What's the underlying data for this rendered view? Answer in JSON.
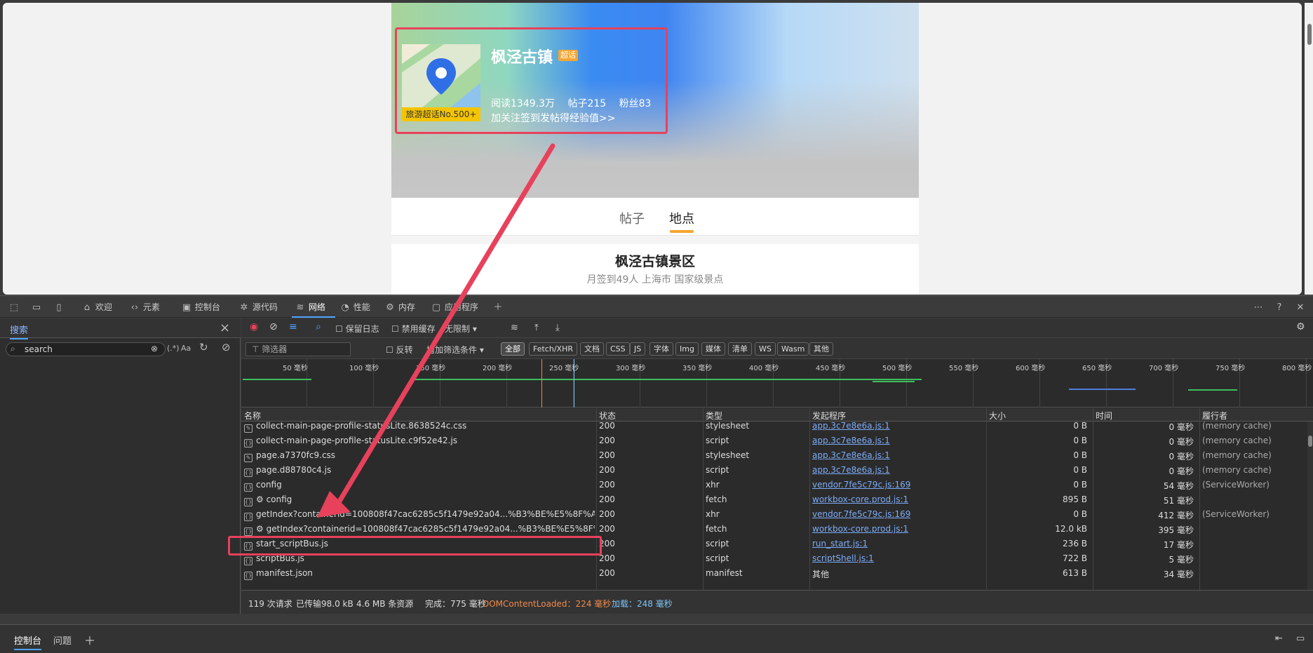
{
  "page": {
    "topic_title": "枫泾古镇",
    "topic_badge": "超话",
    "rank_label": "旅游超话No.500+",
    "stats": {
      "reads": "阅读1349.3万",
      "posts": "帖子215",
      "fans": "粉丝83"
    },
    "cta": "加关注签到发帖得经验值>>",
    "tabs": [
      "帖子",
      "地点"
    ],
    "card_title": "枫泾古镇景区",
    "card_sub": "月签到49人 上海市 国家级景点"
  },
  "devtools": {
    "tabs": [
      "欢迎",
      "元素",
      "控制台",
      "源代码",
      "网络",
      "性能",
      "内存",
      "应用程序"
    ],
    "active_tab": "网络",
    "search": {
      "tab": "搜索",
      "value": "search",
      "regex": "(.*)",
      "case": "Aa"
    },
    "network_bar": {
      "preserve_log": "保留日志",
      "disable_cache": "禁用缓存",
      "throttle": "无限制"
    },
    "filter": {
      "placeholder": "筛选器",
      "invert": "反转",
      "more": "增加筛选条件"
    },
    "chips": [
      "全部",
      "Fetch/XHR",
      "文档",
      "CSS",
      "JS",
      "字体",
      "Img",
      "媒体",
      "清单",
      "WS",
      "Wasm",
      "其他"
    ],
    "timeline_ticks": [
      "50 毫秒",
      "100 毫秒",
      "150 毫秒",
      "200 毫秒",
      "250 毫秒",
      "300 毫秒",
      "350 毫秒",
      "400 毫秒",
      "450 毫秒",
      "500 毫秒",
      "550 毫秒",
      "600 毫秒",
      "650 毫秒",
      "700 毫秒",
      "750 毫秒",
      "800 毫秒"
    ],
    "columns": [
      "名称",
      "状态",
      "类型",
      "发起程序",
      "大小",
      "时间",
      "履行者"
    ],
    "rows": [
      {
        "name": "collect-main-page-profile-statusLite.8638524c.css",
        "status": "200",
        "type": "stylesheet",
        "initiator": "app.3c7e8e6a.js:1",
        "size": "0 B",
        "time": "0 毫秒",
        "fulfilled": "(memory cache)"
      },
      {
        "name": "collect-main-page-profile-statusLite.c9f52e42.js",
        "status": "200",
        "type": "script",
        "initiator": "app.3c7e8e6a.js:1",
        "size": "0 B",
        "time": "0 毫秒",
        "fulfilled": "(memory cache)"
      },
      {
        "name": "page.a7370fc9.css",
        "status": "200",
        "type": "stylesheet",
        "initiator": "app.3c7e8e6a.js:1",
        "size": "0 B",
        "time": "0 毫秒",
        "fulfilled": "(memory cache)"
      },
      {
        "name": "page.d88780c4.js",
        "status": "200",
        "type": "script",
        "initiator": "app.3c7e8e6a.js:1",
        "size": "0 B",
        "time": "0 毫秒",
        "fulfilled": "(memory cache)"
      },
      {
        "name": "config",
        "status": "200",
        "type": "xhr",
        "initiator": "vendor.7fe5c79c.js:169",
        "size": "0 B",
        "time": "54 毫秒",
        "fulfilled": "(ServiceWorker)"
      },
      {
        "name": "⚙ config",
        "status": "200",
        "type": "fetch",
        "initiator": "workbox-core.prod.js:1",
        "size": "895 B",
        "time": "51 毫秒",
        "fulfilled": ""
      },
      {
        "name": "getIndex?containerid=100808f47cac6285c5f1479e92a04...%B3%BE%E5%8F%A4%E9%95...",
        "status": "200",
        "type": "xhr",
        "initiator": "vendor.7fe5c79c.js:169",
        "size": "0 B",
        "time": "412 毫秒",
        "fulfilled": "(ServiceWorker)"
      },
      {
        "name": "⚙ getIndex?containerid=100808f47cac6285c5f1479e92a04...%B3%BE%E5%8F%A4%E9%...",
        "status": "200",
        "type": "fetch",
        "initiator": "workbox-core.prod.js:1",
        "size": "12.0 kB",
        "time": "395 毫秒",
        "fulfilled": ""
      },
      {
        "name": "start_scriptBus.js",
        "status": "200",
        "type": "script",
        "initiator": "run_start.js:1",
        "size": "236 B",
        "time": "17 毫秒",
        "fulfilled": ""
      },
      {
        "name": "scriptBus.js",
        "status": "200",
        "type": "script",
        "initiator": "scriptShell.js:1",
        "size": "722 B",
        "time": "5 毫秒",
        "fulfilled": ""
      },
      {
        "name": "manifest.json",
        "status": "200",
        "type": "manifest",
        "initiator": "其他",
        "size": "613 B",
        "time": "34 毫秒",
        "fulfilled": ""
      }
    ],
    "status_bar": {
      "requests": "119 次请求",
      "transferred": "已传输98.0 kB",
      "resources": "4.6 MB 条资源",
      "finish": "完成：775 毫秒",
      "dcl": "DOMContentLoaded：224 毫秒",
      "load": "加载：248 毫秒"
    },
    "drawer": {
      "console": "控制台",
      "issues": "问题"
    }
  },
  "colors": {
    "accent": "#4fa3ff",
    "highlight": "#e8415b",
    "badge": "#f6a532"
  }
}
